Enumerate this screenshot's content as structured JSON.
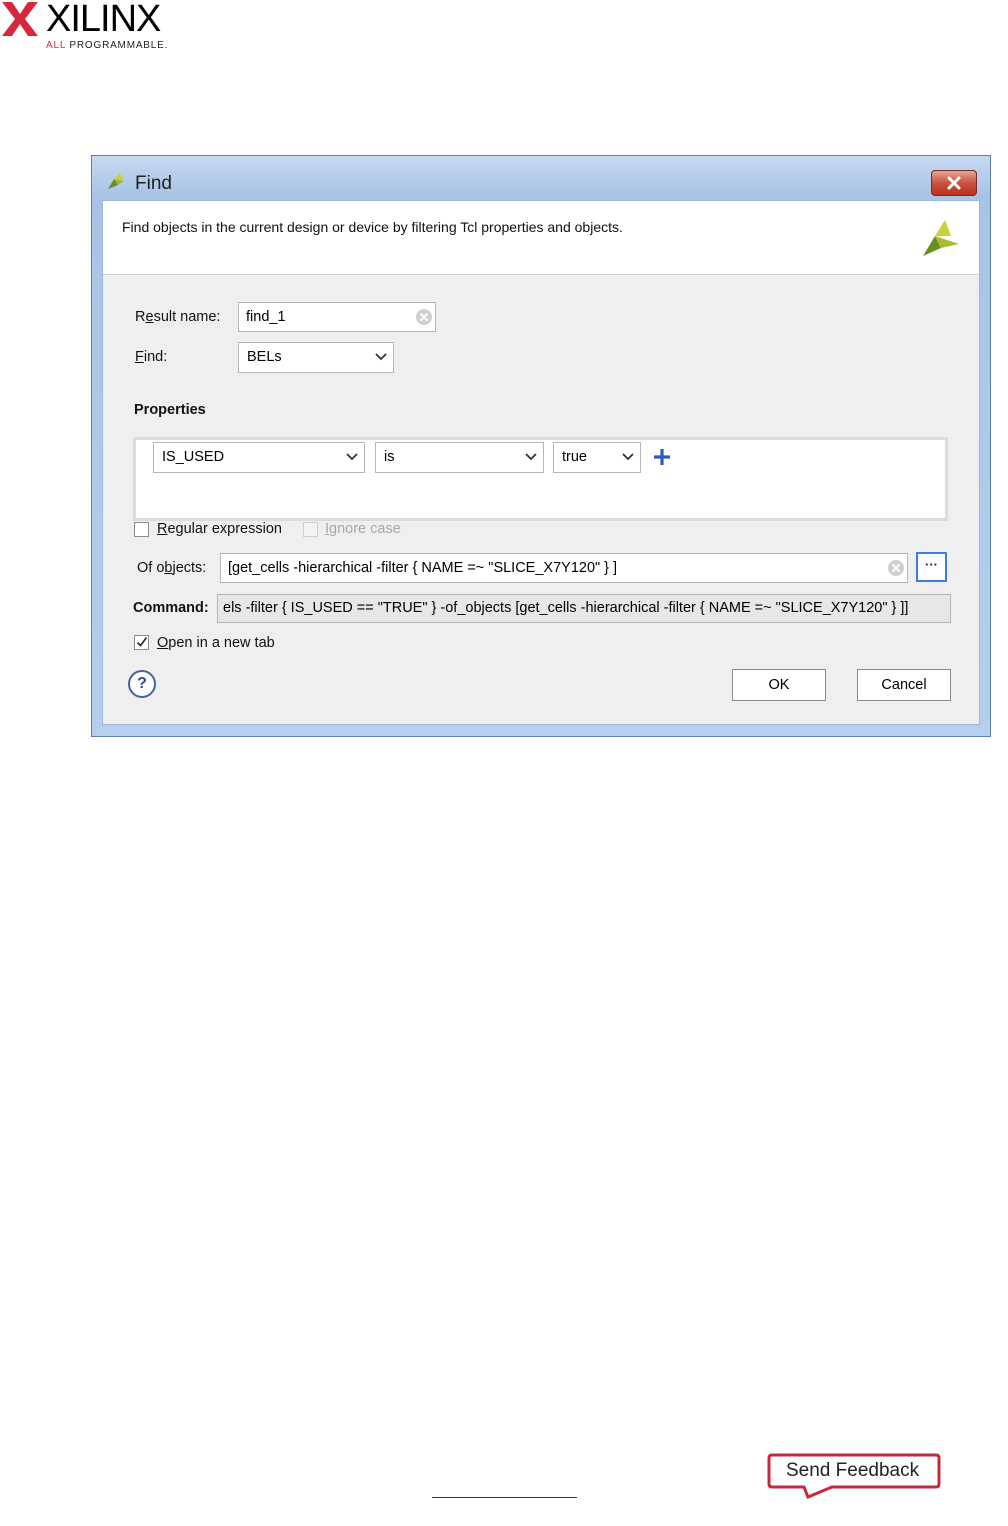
{
  "logo": {
    "brand": "XILINX",
    "tagline_all": "ALL",
    "tagline_rest": "PROGRAMMABLE."
  },
  "dialog": {
    "title": "Find",
    "description": "Find objects in the current design or device by filtering Tcl properties and objects.",
    "result_name": {
      "label_pre": "R",
      "label_u": "e",
      "label_post": "sult name:",
      "value": "find_1"
    },
    "find": {
      "label_u": "F",
      "label_post": "ind:",
      "value": "BELs"
    },
    "properties_label": "Properties",
    "filter": {
      "property": "IS_USED",
      "operator": "is",
      "value": "true"
    },
    "regular_expression": {
      "label_u": "R",
      "label_post": "egular expression",
      "checked": false
    },
    "ignore_case": {
      "label_u": "I",
      "label_post": "gnore case",
      "checked": false,
      "enabled": false
    },
    "of_objects": {
      "label_pre": "Of o",
      "label_u": "b",
      "label_post": "jects:",
      "value": "[get_cells -hierarchical -filter { NAME =~  \"SLICE_X7Y120\" } ]",
      "browse": "···"
    },
    "command": {
      "label": "Command:",
      "value": "els -filter { IS_USED == \"TRUE\" }  -of_objects [get_cells -hierarchical -filter { NAME =~  \"SLICE_X7Y120\" } ]]"
    },
    "open_new_tab": {
      "label_u": "O",
      "label_post": "pen in a new tab",
      "checked": true
    },
    "help": "?",
    "ok": "OK",
    "cancel": "Cancel"
  },
  "footer": {
    "send_feedback": "Send Feedback"
  },
  "colors": {
    "xilinx_red": "#d6283c",
    "title_gradient_top": "#c6d9f1",
    "accent_blue": "#3c7fd6"
  }
}
